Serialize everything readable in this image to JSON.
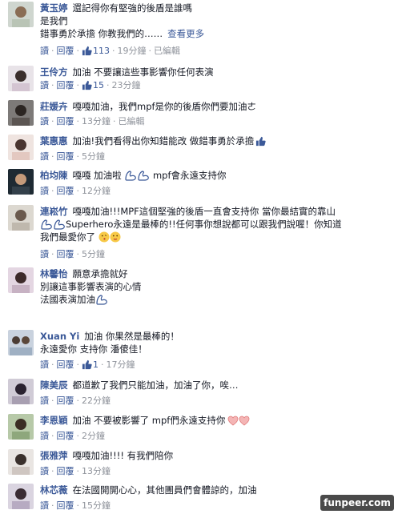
{
  "labels": {
    "reply": "回覆",
    "edited": "已編輯",
    "more": "查看更多",
    "read": "讀"
  },
  "comments": [
    {
      "name": "黃玉婷",
      "lines": [
        "還記得你有堅強的後盾是誰嗎",
        "是我們",
        "錯事勇於承擔 你教我們的……"
      ],
      "likes": "113",
      "time": "19分鐘",
      "edited": true,
      "has_more": true
    },
    {
      "name": "王伶方",
      "lines": [
        "加油 不要讓這些事影響你任何表演"
      ],
      "likes": "15",
      "time": "23分鐘",
      "edited": false
    },
    {
      "name": "莊媛卉",
      "lines": [
        "嘎嘎加油，我們mpf是你的後盾你們要加油ㄜ"
      ],
      "likes": "",
      "time": "13分鐘",
      "edited": true
    },
    {
      "name": "葉惠惠",
      "lines": [
        "加油!我們看得出你知錯能改 做錯事勇於承擔"
      ],
      "likes": "",
      "time": "5分鐘",
      "edited": false
    },
    {
      "name": "柏均陳",
      "lines": [
        "嘎嘎 加油啦",
        "mpf會永遠支持你"
      ],
      "likes": "",
      "time": "12分鐘",
      "edited": false
    },
    {
      "name": "連崧竹",
      "lines": [
        "嘎嘎加油!!!MPF這個堅強的後盾一直會支持你 當你最結實的靠山",
        "Superhero永遠是最棒的!!任何事你想說都可以跟我們說喔！你知道",
        "我們最愛你了"
      ],
      "likes": "",
      "time": "5分鐘",
      "edited": false
    },
    {
      "name": "林馨怡",
      "lines": [
        "願意承擔就好",
        "別讓這事影響表演的心情",
        "法國表演加油"
      ],
      "likes": "",
      "time": "",
      "edited": false
    },
    {
      "name": "Xuan Yi",
      "lines": [
        "加油 你果然是最棒的！",
        "永遠愛你 支持你 潘傻佳！"
      ],
      "likes": "1",
      "time": "17分鐘",
      "edited": false
    },
    {
      "name": "陳美辰",
      "lines": [
        "都道歉了我們只能加油，加油了你，唉…"
      ],
      "likes": "",
      "time": "22分鐘",
      "edited": false
    },
    {
      "name": "李恩穎",
      "lines": [
        "加油 不要被影響了 mpf們永遠支持你"
      ],
      "likes": "",
      "time": "2分鐘",
      "edited": false
    },
    {
      "name": "張雅萍",
      "lines": [
        "嘎嘎加油!!!! 有我們陪你"
      ],
      "likes": "",
      "time": "13分鐘",
      "edited": false
    },
    {
      "name": "林芯薇",
      "lines": [
        "在法國開開心心，其他團員們會體諒的，加油"
      ],
      "likes": "",
      "time": "15分鐘",
      "edited": false
    }
  ],
  "watermark": "funpeer.com",
  "colors": {
    "link": "#3b5998",
    "meta": "#90949c",
    "text": "#141823"
  }
}
